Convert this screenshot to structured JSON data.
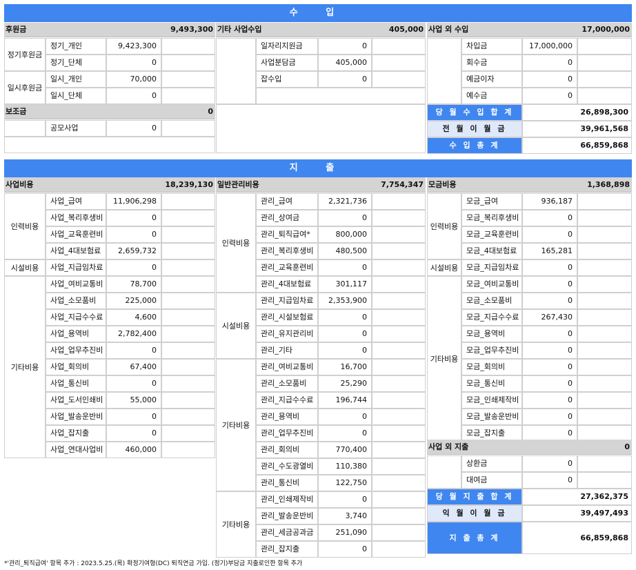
{
  "income": {
    "title": "수 입",
    "sponsorship": {
      "title": "후원금",
      "total": "9,493,300",
      "groups": [
        {
          "name": "정기후원금",
          "items": [
            {
              "label": "정기_개인",
              "value": "9,423,300"
            },
            {
              "label": "정기_단체",
              "value": "0"
            }
          ]
        },
        {
          "name": "일시후원금",
          "items": [
            {
              "label": "일시_개인",
              "value": "70,000"
            },
            {
              "label": "일시_단체",
              "value": "0"
            }
          ]
        }
      ]
    },
    "subsidy": {
      "title": "보조금",
      "total": "0",
      "items": [
        {
          "label": "공모사업",
          "value": "0"
        }
      ]
    },
    "other_business": {
      "title": "기타 사업수입",
      "total": "405,000",
      "items": [
        {
          "label": "일자리지원금",
          "value": "0"
        },
        {
          "label": "사업분담금",
          "value": "405,000"
        },
        {
          "label": "잡수입",
          "value": "0"
        }
      ]
    },
    "non_business": {
      "title": "사업 외 수입",
      "total": "17,000,000",
      "items": [
        {
          "label": "차입금",
          "value": "17,000,000"
        },
        {
          "label": "회수금",
          "value": "0"
        },
        {
          "label": "예금이자",
          "value": "0"
        },
        {
          "label": "예수금",
          "value": "0"
        }
      ]
    },
    "summary": {
      "month_total_label": "당 월 수 입 합 계",
      "month_total": "26,898,300",
      "carryover_label": "전 월 이 월 금",
      "carryover": "39,961,568",
      "grand_total_label": "수 입 총 계",
      "grand_total": "66,859,868"
    }
  },
  "expense": {
    "title": "지 출",
    "business": {
      "title": "사업비용",
      "total": "18,239,130",
      "groups": [
        {
          "name": "인력비용",
          "items": [
            {
              "label": "사업_급여",
              "value": "11,906,298"
            },
            {
              "label": "사업_복리후생비",
              "value": "0"
            },
            {
              "label": "사업_교육훈련비",
              "value": "0"
            },
            {
              "label": "사업_4대보험료",
              "value": "2,659,732"
            }
          ]
        },
        {
          "name": "시설비용",
          "items": [
            {
              "label": "사업_지급임차료",
              "value": "0"
            }
          ]
        },
        {
          "name": "기타비용",
          "items": [
            {
              "label": "사업_여비교통비",
              "value": "78,700"
            },
            {
              "label": "사업_소모품비",
              "value": "225,000"
            },
            {
              "label": "사업_지급수수료",
              "value": "4,600"
            },
            {
              "label": "사업_용역비",
              "value": "2,782,400"
            },
            {
              "label": "사업_업무추진비",
              "value": "0"
            },
            {
              "label": "사업_회의비",
              "value": "67,400"
            },
            {
              "label": "사업_통신비",
              "value": "0"
            },
            {
              "label": "사업_도서인쇄비",
              "value": "55,000"
            },
            {
              "label": "사업_발송운반비",
              "value": "0"
            },
            {
              "label": "사업_잡지출",
              "value": "0"
            },
            {
              "label": "사업_연대사업비",
              "value": "460,000"
            }
          ]
        }
      ]
    },
    "admin": {
      "title": "일반관리비용",
      "total": "7,754,347",
      "groups": [
        {
          "name": "인력비용",
          "items": [
            {
              "label": "관리_급여",
              "value": "2,321,736"
            },
            {
              "label": "관리_상여금",
              "value": "0"
            },
            {
              "label": "관리_퇴직급여*",
              "value": "800,000"
            },
            {
              "label": "관리_복리후생비",
              "value": "480,500"
            },
            {
              "label": "관리_교육훈련비",
              "value": "0"
            },
            {
              "label": "관리_4대보험료",
              "value": "301,117"
            }
          ]
        },
        {
          "name": "시설비용",
          "items": [
            {
              "label": "관리_지급임차료",
              "value": "2,353,900"
            },
            {
              "label": "관리_시설보험료",
              "value": "0"
            },
            {
              "label": "관리_유지관리비",
              "value": "0"
            },
            {
              "label": "관리_기타",
              "value": "0"
            }
          ]
        },
        {
          "name": "기타비용",
          "items": [
            {
              "label": "관리_여비교통비",
              "value": "16,700"
            },
            {
              "label": "관리_소모품비",
              "value": "25,290"
            },
            {
              "label": "관리_지급수수료",
              "value": "196,744"
            },
            {
              "label": "관리_용역비",
              "value": "0"
            },
            {
              "label": "관리_업무추진비",
              "value": "0"
            },
            {
              "label": "관리_회의비",
              "value": "770,400"
            },
            {
              "label": "관리_수도광열비",
              "value": "110,380"
            },
            {
              "label": "관리_통신비",
              "value": "122,750"
            }
          ]
        },
        {
          "name": "기타비용",
          "items": [
            {
              "label": "관리_인쇄제작비",
              "value": "0"
            },
            {
              "label": "관리_발송운반비",
              "value": "3,740"
            },
            {
              "label": "관리_세금공과금",
              "value": "251,090"
            },
            {
              "label": "관리_잡지출",
              "value": "0"
            }
          ]
        }
      ]
    },
    "fundraising": {
      "title": "모금비용",
      "total": "1,368,898",
      "groups": [
        {
          "name": "인력비용",
          "items": [
            {
              "label": "모금_급여",
              "value": "936,187"
            },
            {
              "label": "모금_복리후생비",
              "value": "0"
            },
            {
              "label": "모금_교육훈련비",
              "value": "0"
            },
            {
              "label": "모금_4대보험료",
              "value": "165,281"
            }
          ]
        },
        {
          "name": "시설비용",
          "items": [
            {
              "label": "모금_지급임차료",
              "value": "0"
            }
          ]
        },
        {
          "name": "기타비용",
          "items": [
            {
              "label": "모금_여비교통비",
              "value": "0"
            },
            {
              "label": "모금_소모품비",
              "value": "0"
            },
            {
              "label": "모금_지급수수료",
              "value": "267,430"
            },
            {
              "label": "모금_용역비",
              "value": "0"
            },
            {
              "label": "모금_업무추진비",
              "value": "0"
            },
            {
              "label": "모금_회의비",
              "value": "0"
            },
            {
              "label": "모금_통신비",
              "value": "0"
            },
            {
              "label": "모금_인쇄제작비",
              "value": "0"
            },
            {
              "label": "모금_발송운반비",
              "value": "0"
            },
            {
              "label": "모금_잡지출",
              "value": "0"
            }
          ]
        }
      ]
    },
    "non_business": {
      "title": "사업 외 지출",
      "total": "0",
      "items": [
        {
          "label": "상환금",
          "value": "0"
        },
        {
          "label": "대여금",
          "value": "0"
        }
      ]
    },
    "summary": {
      "month_total_label": "당 월 지 출 합 계",
      "month_total": "27,362,375",
      "carryover_label": "익 월 이 월 금",
      "carryover": "39,497,493",
      "grand_total_label": "지 출 총 계",
      "grand_total": "66,859,868"
    }
  },
  "footnote": "*'관리_퇴직급여' 항목 추가 : 2023.5.25.(목) 확정기여형(DC) 퇴직연금 가입. (정기)부담금 지출로인한 항목 추가"
}
